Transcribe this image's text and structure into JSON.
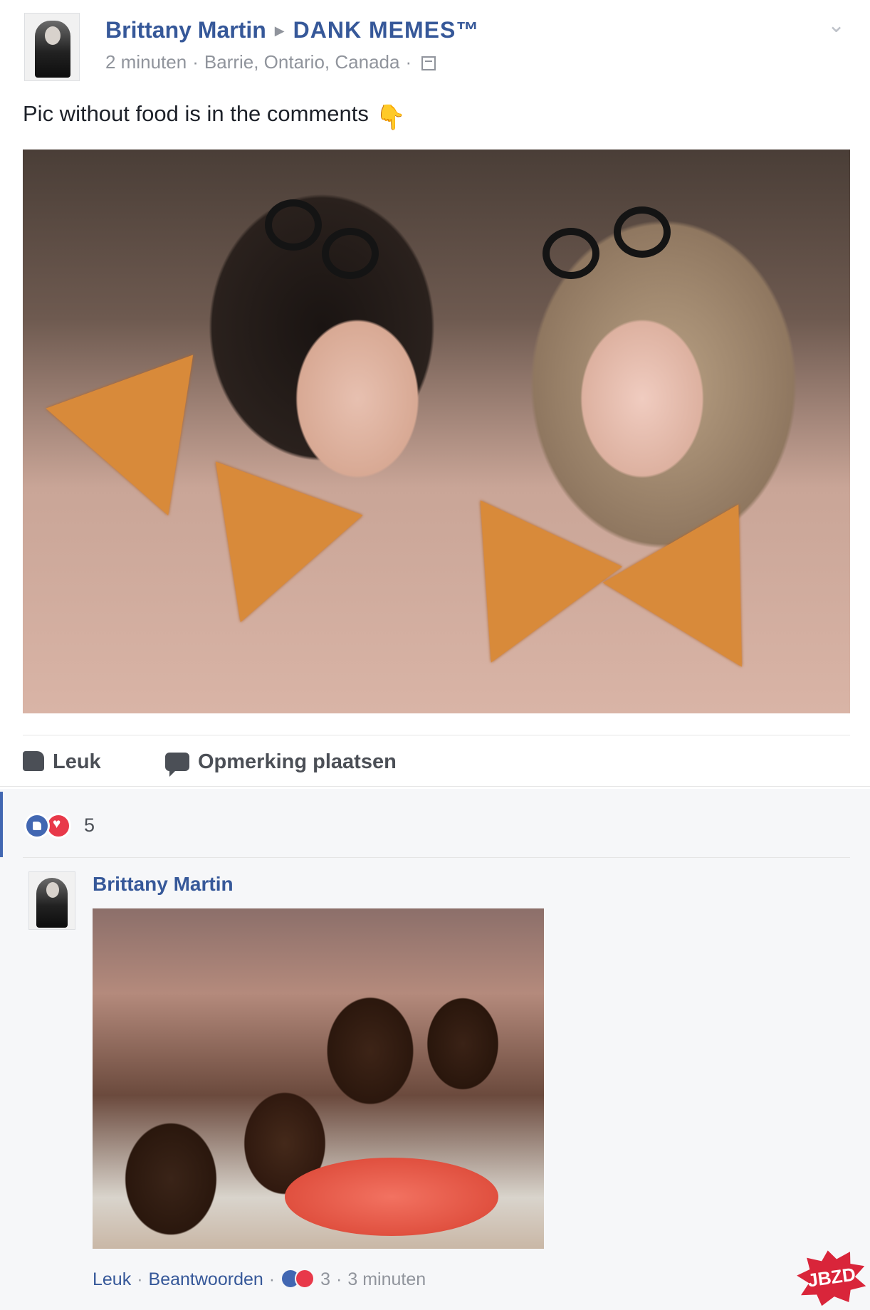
{
  "post": {
    "author": "Brittany Martin",
    "group": "DANK MEMES™",
    "time": "2 minuten",
    "location": "Barrie, Ontario, Canada",
    "text": "Pic without food is in the comments",
    "emoji": "👇",
    "privacy_icon": "calendar-icon",
    "menu_icon": "chevron-down-icon"
  },
  "actions": {
    "like_label": "Leuk",
    "comment_label": "Opmerking plaatsen"
  },
  "reactions": {
    "count": "5",
    "types": [
      "like",
      "love"
    ]
  },
  "comment": {
    "author": "Brittany Martin",
    "like_label": "Leuk",
    "reply_label": "Beantwoorden",
    "reaction_count": "3",
    "time": "3 minuten"
  },
  "watermark": "JBZD",
  "colors": {
    "link": "#365899",
    "meta": "#90949c",
    "like_blue": "#4267b2",
    "love_red": "#e8394a",
    "watermark_red": "#d9253a"
  }
}
